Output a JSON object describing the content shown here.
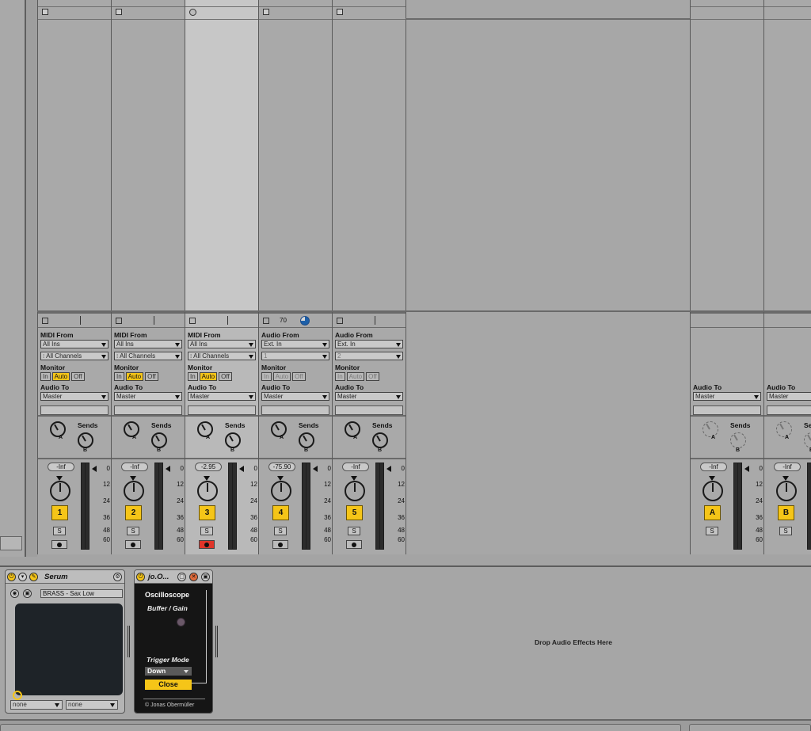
{
  "tracks": [
    {
      "midi": true,
      "from_label": "MIDI From",
      "from": "All Ins",
      "channel": "All Channels",
      "monitor_label": "Monitor",
      "monitor": [
        "In",
        "Auto",
        "Off"
      ],
      "monitor_active": "Auto",
      "to_label": "Audio To",
      "to": "Master",
      "sends_label": "Sends",
      "send_a": "A",
      "send_b": "B",
      "volume": "-Inf",
      "number": "1",
      "solo": "S",
      "selected": false
    },
    {
      "midi": true,
      "from_label": "MIDI From",
      "from": "All Ins",
      "channel": "All Channels",
      "monitor_label": "Monitor",
      "monitor": [
        "In",
        "Auto",
        "Off"
      ],
      "monitor_active": "Auto",
      "to_label": "Audio To",
      "to": "Master",
      "sends_label": "Sends",
      "send_a": "A",
      "send_b": "B",
      "volume": "-Inf",
      "number": "2",
      "solo": "S",
      "selected": false
    },
    {
      "midi": true,
      "from_label": "MIDI From",
      "from": "All Ins",
      "channel": "All Channels",
      "monitor_label": "Monitor",
      "monitor": [
        "In",
        "Auto",
        "Off"
      ],
      "monitor_active": "Auto",
      "to_label": "Audio To",
      "to": "Master",
      "sends_label": "Sends",
      "send_a": "A",
      "send_b": "B",
      "volume": "-2.95",
      "number": "3",
      "solo": "S",
      "selected": true,
      "armed": true
    },
    {
      "midi": false,
      "from_label": "Audio From",
      "from": "Ext. In",
      "channel": "1",
      "monitor_label": "Monitor",
      "monitor": [
        "In",
        "Auto",
        "Off"
      ],
      "monitor_active": "",
      "to_label": "Audio To",
      "to": "Master",
      "sends_label": "Sends",
      "send_a": "A",
      "send_b": "B",
      "volume": "-75.90",
      "number": "4",
      "solo": "S",
      "selected": false,
      "topbar_num": "70"
    },
    {
      "midi": false,
      "from_label": "Audio From",
      "from": "Ext. In",
      "channel": "2",
      "monitor_label": "Monitor",
      "monitor": [
        "In",
        "Auto",
        "Off"
      ],
      "monitor_active": "",
      "to_label": "Audio To",
      "to": "Master",
      "sends_label": "Sends",
      "send_a": "A",
      "send_b": "B",
      "volume": "-Inf",
      "number": "5",
      "solo": "S",
      "selected": false
    }
  ],
  "returns": [
    {
      "to_label": "Audio To",
      "to": "Master",
      "sends_label": "Sends",
      "send_a": "A",
      "send_b": "B",
      "volume": "-Inf",
      "number": "A",
      "solo": "S"
    },
    {
      "to_label": "Audio To",
      "to": "Master",
      "sends_label": "Sends",
      "send_a": "A",
      "send_b": "B",
      "volume": "-Inf",
      "number": "B",
      "solo": "S"
    }
  ],
  "meter_scale": [
    "0",
    "12",
    "24",
    "36",
    "48",
    "60"
  ],
  "devices": {
    "serum": {
      "title": "Serum",
      "preset": "BRASS - Sax Low",
      "chooser1": "none",
      "chooser2": "none"
    },
    "osc": {
      "title": "jo.O...",
      "heading": "Oscilloscope",
      "buffer_label": "Buffer / Gain",
      "trigger_label": "Trigger Mode",
      "trigger_value": "Down",
      "close_label": "Close",
      "copyright": "© Jonas Obermüller"
    },
    "drop_text": "Drop Audio Effects Here"
  },
  "colors": {
    "accent": "#f5c518",
    "armed": "#e0352a"
  }
}
